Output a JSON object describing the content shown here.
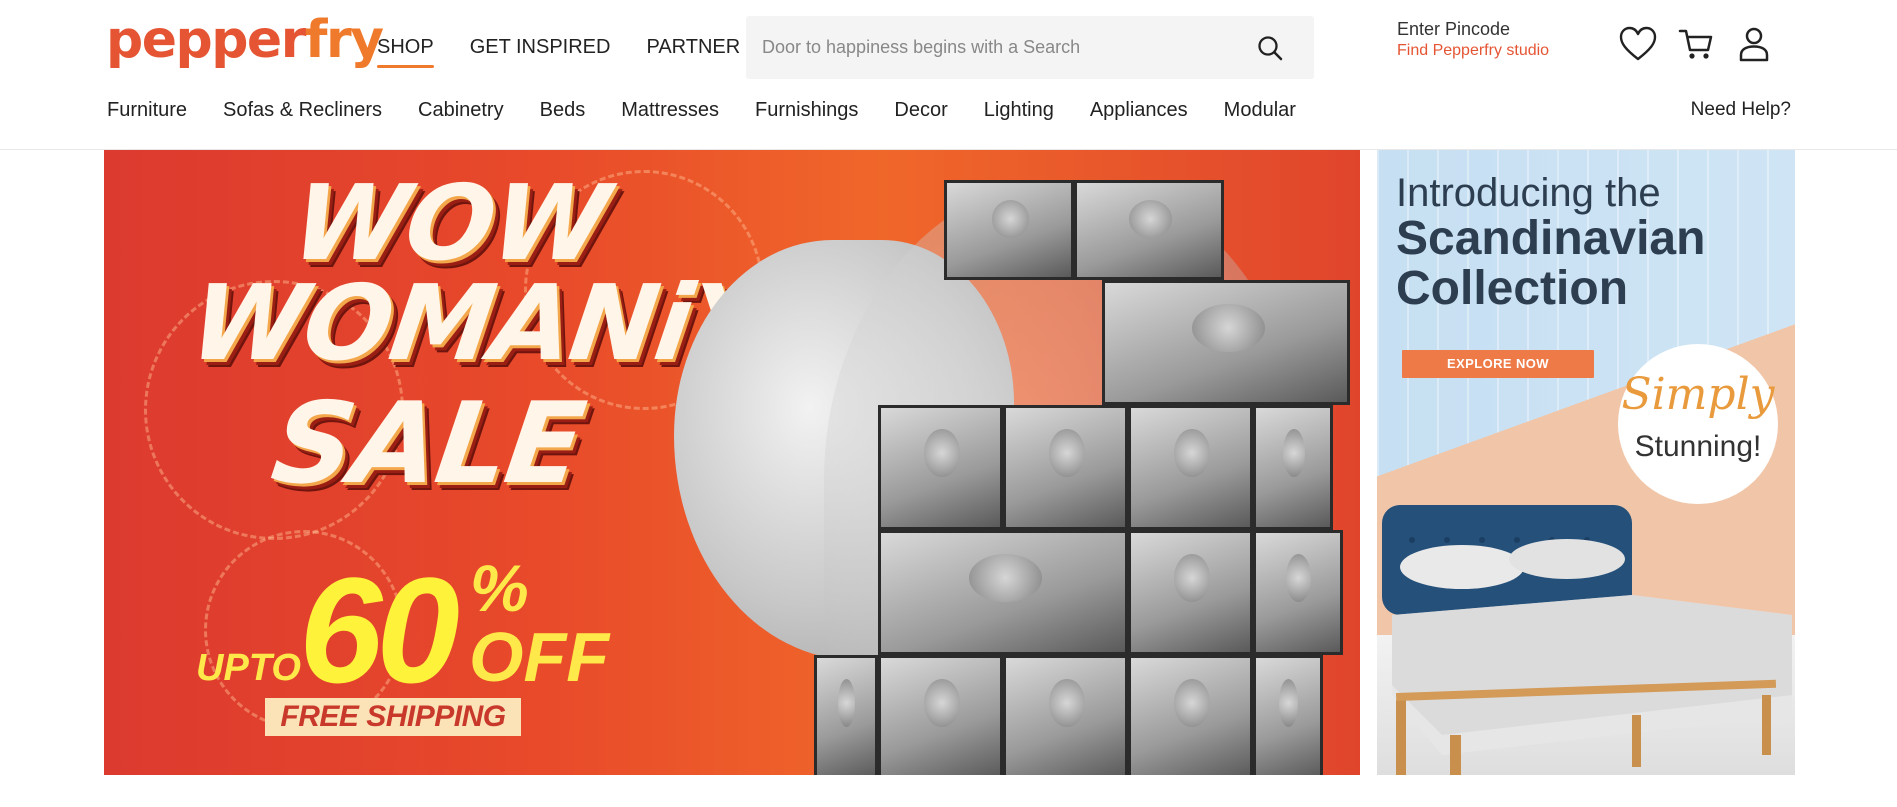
{
  "brand": {
    "logo_part1": "pepper",
    "logo_part2": "fry"
  },
  "topnav": {
    "shop": "SHOP",
    "inspired": "GET INSPIRED",
    "partner": "PARTNER"
  },
  "search": {
    "placeholder": "Door to happiness begins with a Search"
  },
  "pincode": {
    "enter": "Enter Pincode",
    "studio": "Find Pepperfry studio"
  },
  "icons": [
    "heart-icon",
    "cart-icon",
    "user-icon"
  ],
  "categories": [
    "Furniture",
    "Sofas & Recliners",
    "Cabinetry",
    "Beds",
    "Mattresses",
    "Furnishings",
    "Decor",
    "Lighting",
    "Appliances",
    "Modular"
  ],
  "help": "Need Help?",
  "hero": {
    "line1": "WOW",
    "line2": "WOMANiYA",
    "line3": "SALE",
    "upto": "UPTO",
    "amount": "60",
    "percent": "%",
    "off": "OFF",
    "shipping": "FREE SHIPPING"
  },
  "side_banner": {
    "intro": "Introducing the",
    "title_line1": "Scandinavian",
    "title_line2": "Collection",
    "cta": "EXPLORE NOW",
    "badge_script": "Simply",
    "badge_text": "Stunning!"
  },
  "colors": {
    "brand_red": "#e55533",
    "brand_orange": "#f07a2c",
    "hero_yellow": "#fff23a",
    "cta_orange": "#ee7a48"
  }
}
